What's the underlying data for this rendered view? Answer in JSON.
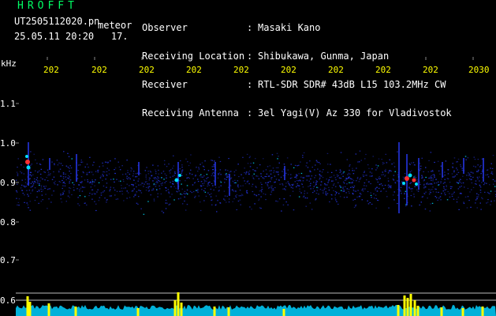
{
  "header": {
    "logo": "HROFFT",
    "filename": "UT2505112020.pn",
    "category": "meteor",
    "timestamp": "25.05.11 20:20",
    "number": "17."
  },
  "info": [
    {
      "label": "Observer",
      "value": "Masaki Kano"
    },
    {
      "label": "Receiving Location",
      "value": "Shibukawa, Gunma, Japan"
    },
    {
      "label": "Receiver",
      "value": "RTL-SDR SDR# 43dB L15 103.2MHz CW"
    },
    {
      "label": "Receiving Antenna",
      "value": "3el Yagi(V) Az 330 for Vladivostok"
    }
  ],
  "axes": {
    "y_unit": "kHz",
    "y_ticks": [
      "1.1",
      "1.0",
      "0.9",
      "0.8",
      "0.7",
      "0.6"
    ],
    "x_ticks": [
      "202",
      "202",
      "202",
      "202",
      "202",
      "202",
      "202",
      "202",
      "202",
      "2030"
    ]
  },
  "colors": {
    "background": "#000000",
    "label_text": "#ffffff",
    "tick_text": "#ffff00",
    "logo": "#00ff66",
    "signal_low": "#2a3cff",
    "signal_mid": "#00e0ff",
    "signal_high": "#ff3030",
    "power_bar": "#ffff00",
    "noise_floor": "#00d0ff"
  }
}
